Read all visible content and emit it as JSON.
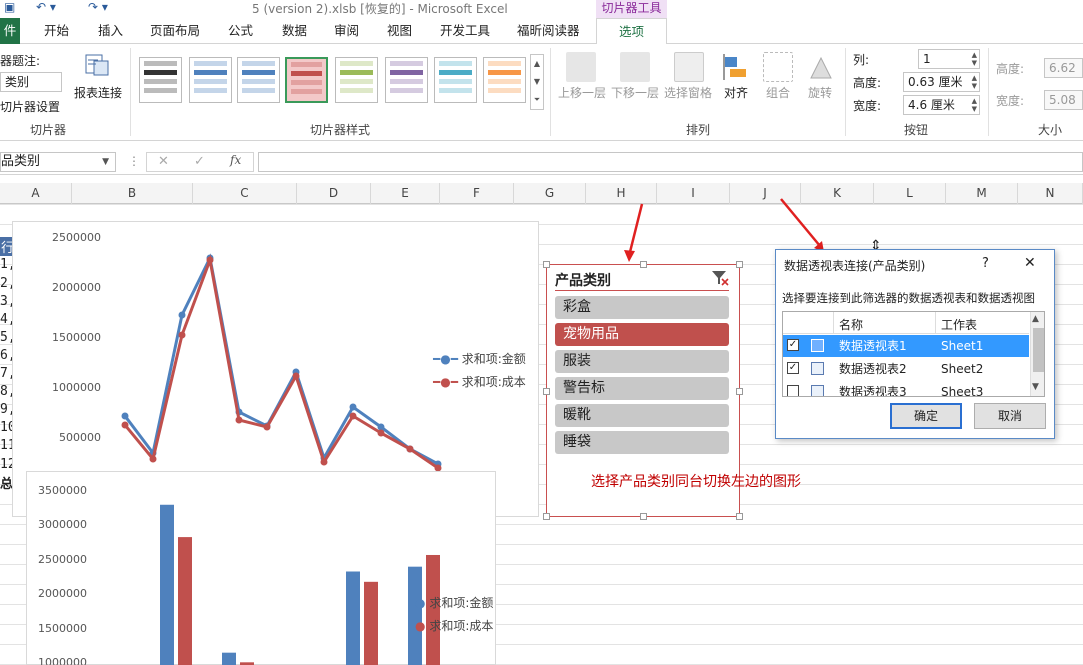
{
  "titlebar": {
    "title": "5 (version 2).xlsb [恢复的] - Microsoft Excel",
    "context_group": "切片器工具"
  },
  "tabs": [
    "件",
    "开始",
    "插入",
    "页面布局",
    "公式",
    "数据",
    "审阅",
    "视图",
    "开发工具",
    "福昕阅读器",
    "选项"
  ],
  "ribbon": {
    "slicer_group": {
      "caption_label": "器题注:",
      "caption_value": "类别",
      "settings": "切片器设置",
      "report_conn": "报表连接",
      "label": "切片器"
    },
    "styles_group": {
      "label": "切片器样式"
    },
    "arrange_group": {
      "items": [
        "上移一层",
        "下移一层",
        "选择窗格",
        "对齐",
        "组合",
        "旋转"
      ],
      "label": "排列"
    },
    "buttons_group": {
      "cols_label": "列:",
      "cols_value": "1",
      "height_label": "高度:",
      "height_value": "0.63 厘米",
      "width_label": "宽度:",
      "width_value": "4.6 厘米",
      "label": "按钮"
    },
    "size_group": {
      "height_label": "高度:",
      "height_value": "6.62",
      "width_label": "宽度:",
      "width_value": "5.08",
      "label": "大小"
    }
  },
  "formula_bar": {
    "name_box": "品类别",
    "fx": "fx"
  },
  "columns": [
    "A",
    "B",
    "C",
    "D",
    "E",
    "F",
    "G",
    "H",
    "I",
    "J",
    "K",
    "L",
    "M",
    "N"
  ],
  "row_labels": [
    "行",
    "1,",
    "2,",
    "3,",
    "4,",
    "5,",
    "6,",
    "7,",
    "8,",
    "9,",
    "10",
    "11",
    "12",
    "总"
  ],
  "slicer": {
    "title": "产品类别",
    "items": [
      "彩盒",
      "宠物用品",
      "服装",
      "警告标",
      "暖靴",
      "睡袋"
    ],
    "selected_index": 1,
    "note": "选择产品类别同台切换左边的图形"
  },
  "dialog": {
    "title": "数据透视表连接(产品类别)",
    "help": "?",
    "close": "✕",
    "instruction": "选择要连接到此筛选器的数据透视表和数据透视图",
    "col_name": "名称",
    "col_sheet": "工作表",
    "rows": [
      {
        "checked": true,
        "name": "数据透视表1",
        "sheet": "Sheet1",
        "selected": true
      },
      {
        "checked": true,
        "name": "数据透视表2",
        "sheet": "Sheet2",
        "selected": false
      },
      {
        "checked": false,
        "name": "数据透视表3",
        "sheet": "Sheet3",
        "selected": false
      }
    ],
    "ok": "确定",
    "cancel": "取消"
  },
  "colors": {
    "excel_green": "#217346",
    "series_amount": "#4f81bd",
    "series_cost": "#c0504d",
    "annotation_red": "#c00000"
  },
  "chart_data": [
    {
      "type": "line",
      "series": [
        {
          "name": "求和项:金额",
          "values": [
            720000,
            350000,
            1730000,
            2300000,
            760000,
            620000,
            1160000,
            300000,
            810000,
            610000,
            390000,
            240000
          ]
        },
        {
          "name": "求和项:成本",
          "values": [
            630000,
            290000,
            1530000,
            2280000,
            680000,
            610000,
            1120000,
            260000,
            720000,
            550000,
            390000,
            200000
          ]
        }
      ],
      "ytick_labels": [
        "500000",
        "1000000",
        "1500000",
        "2000000",
        "2500000"
      ],
      "ylim": [
        250000,
        2500000
      ]
    },
    {
      "type": "bar",
      "series": [
        {
          "name": "求和项:金额",
          "values": [
            3300000,
            1150000,
            2330000,
            2400000
          ]
        },
        {
          "name": "求和项:成本",
          "values": [
            2830000,
            1010000,
            2180000,
            2570000
          ]
        }
      ],
      "ytick_labels": [
        "1000000",
        "1500000",
        "2000000",
        "2500000",
        "3000000",
        "3500000"
      ],
      "ylim": [
        1000000,
        3500000
      ]
    }
  ]
}
